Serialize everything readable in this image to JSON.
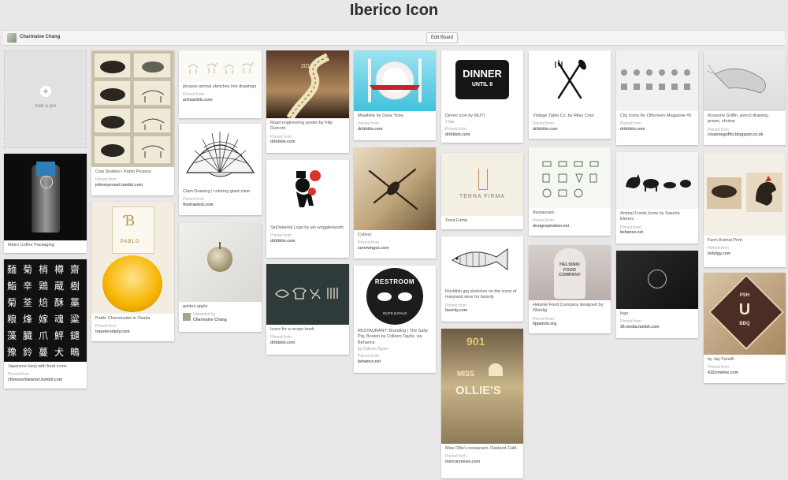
{
  "board": {
    "title": "Iberico Icon",
    "owner": "Charmaine Chang",
    "edit_label": "Edit Board"
  },
  "add_pin": {
    "label": "Add a pin"
  },
  "pins": [
    {
      "desc": "Metro Coffee Packaging"
    },
    {
      "desc": "Japanese kanji with food icons",
      "src_label": "Pinned from",
      "src": "chinesecharacter.tumblr.com"
    },
    {
      "desc": "Cow Studies • Pablo Picasso",
      "src_label": "Pinned from",
      "src": "johnmyersart.tumblr.com"
    },
    {
      "desc": "Pablo Cheesecake in Osaka",
      "src_label": "Pinned from",
      "src": "travelersdaily.com"
    },
    {
      "desc": "picasso animal sketches line drawings",
      "src_label": "Pinned from",
      "src": "artrepublic.com"
    },
    {
      "desc": "Clam Drawing | coloring giant-clam",
      "src_label": "Pinned from",
      "src": "thedrawbot.com"
    },
    {
      "desc": "golden apple",
      "src_label": "Uploaded by",
      "src": "Charmaine Chang"
    },
    {
      "desc": "Road engineering poster by Filip Dumont",
      "src_label": "Pinned from",
      "src": "dribbble.com"
    },
    {
      "desc": "SinDelantal Logo by ian wrigglesworth",
      "src_label": "Pinned from",
      "src": "dribbble.com"
    },
    {
      "desc": "Icons for a recipe book",
      "src_label": "Pinned from",
      "src": "dribbble.com"
    },
    {
      "desc": "Mealtime by Dave Yoon",
      "src_label": "Pinned from",
      "src": "dribbble.com"
    },
    {
      "desc": "Cutlery",
      "src_label": "Pinned from",
      "src": "survivingoz.com"
    },
    {
      "desc": "RESTAURANT: Branding | The Salty Pig, Boston by Colleen Taylor, via Behance",
      "by": "by Colleen Taylor",
      "src_label": "Pinned from",
      "src": "behance.net"
    },
    {
      "desc": "Dinner icon by MUTI",
      "likes": "1 like",
      "src_label": "Pinned from",
      "src": "dribbble.com"
    },
    {
      "desc": "Terra Firma"
    },
    {
      "desc": "Rockfish.jpg sketches on the icons of maryland wine for boordy",
      "src_label": "Pinned from",
      "src": "boordy.com"
    },
    {
      "desc": "Miss Ollie's restaurant, Oakland Calif.",
      "src_label": "Pinned from",
      "src": "mercurynews.com"
    },
    {
      "desc": "Vintage Table Co. by Riley Cran",
      "src_label": "Pinned from",
      "src": "dribbble.com"
    },
    {
      "desc": "Restaurant",
      "src_label": "Pinned from",
      "src": "designspiration.net"
    },
    {
      "desc": "Helsinki Food Company designed by Werklig",
      "src_label": "Pinned from",
      "src": "lippando.org"
    },
    {
      "desc": "City Icons for Offscreen Magazine #5",
      "src_label": "Pinned from",
      "src": "dribbble.com"
    },
    {
      "desc": "Animal Foods Icons by Sascha Elmers",
      "src_label": "Pinned from",
      "src": "behance.net"
    },
    {
      "desc": "logo",
      "src_label": "Pinned from",
      "src": "30.media.tumblr.com"
    },
    {
      "desc": "Roxanne Goffin, pencil drawing, prawn, shrimp",
      "src_label": "Pinned from",
      "src": "roxannegoffin.blogspot.co.uk"
    },
    {
      "desc": "Farm Animal Print.",
      "src_label": "Pinned from",
      "src": "indulgy.com"
    },
    {
      "desc": "by Jay Fanelli",
      "src_label": "Pinned from",
      "src": "412creative.com"
    }
  ],
  "image_text": {
    "road_year": "2012",
    "pablo": "PABLO",
    "restroom": "RESTROOM",
    "restroom_sub": "GUYS & GALS",
    "dinner": "DINNER",
    "until": "UNTIL 8",
    "terra": "TERRA FIRMA",
    "helsinki": "HELSINKI FOOD COMPANY",
    "num": "901",
    "miss": "MISS",
    "ollies": "OLLIE'S",
    "psh": "PSH",
    "bbq": "BBQ",
    "kanji": [
      "麺",
      "菊",
      "梢",
      "樽",
      "齋",
      "鮨",
      "辛",
      "鶏",
      "蔵",
      "樹",
      "菊",
      "荃",
      "焙",
      "酥",
      "藁",
      "粮",
      "烽",
      "嫁",
      "魂",
      "粱",
      "藻",
      "臓",
      "爪",
      "鮃",
      "鑓",
      "豫",
      "鈴",
      "蔓",
      "犬",
      "鴫"
    ]
  }
}
